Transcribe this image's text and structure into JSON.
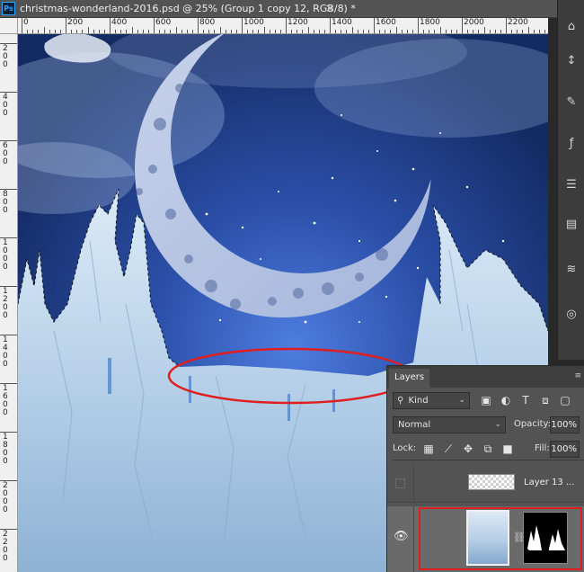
{
  "document": {
    "tab_title": "christmas-wonderland-2016.psd @ 25% (Group 1 copy 12, RGB/8) *",
    "app_badge": "Ps",
    "close_glyph": "×"
  },
  "rulers": {
    "top_labels": [
      "0",
      "200",
      "400",
      "600",
      "800",
      "1000",
      "1200",
      "1400",
      "1600",
      "1800",
      "2000",
      "2200"
    ],
    "left_labels": [
      "2 0 0",
      "4 0 0",
      "6 0 0",
      "8 0 0",
      "1 0 0 0",
      "1 2 0 0",
      "1 4 0 0",
      "1 6 0 0",
      "1 8 0 0",
      "2 0 0 0",
      "2 2 0 0"
    ]
  },
  "tools": [
    "home-icon",
    "text-vertical-icon",
    "pen-icon",
    "italic-f-icon",
    "sliders-icon",
    "stack-icon",
    "wave-icon",
    "shield-icon"
  ],
  "layers_panel": {
    "tab_label": "Layers",
    "menu_glyph": "≡",
    "kind": {
      "search_glyph": "⚲",
      "label": "Kind",
      "chevron": "⌄"
    },
    "filter_icons": [
      "image-filter-icon",
      "adjustment-filter-icon",
      "type-filter-icon",
      "shape-filter-icon",
      "smart-object-filter-icon"
    ],
    "blend_mode": {
      "label": "Normal",
      "chevron": "⌄"
    },
    "opacity": {
      "label": "Opacity:",
      "value": "100%"
    },
    "lock": {
      "label": "Lock:"
    },
    "lock_icons": [
      "lock-transparent-icon",
      "lock-paint-icon",
      "lock-move-icon",
      "lock-artboard-icon",
      "lock-all-icon"
    ],
    "fill": {
      "label": "Fill:",
      "value": "100%"
    },
    "layers": [
      {
        "name": "Layer 13 ...",
        "visible": false
      },
      {
        "name": "",
        "visible": true,
        "selected": true
      }
    ]
  },
  "colors": {
    "annotation_red": "#e01e1e",
    "panel_bg": "#535353",
    "sky_dark": "#14285c",
    "sky_light": "#3e66c8"
  }
}
